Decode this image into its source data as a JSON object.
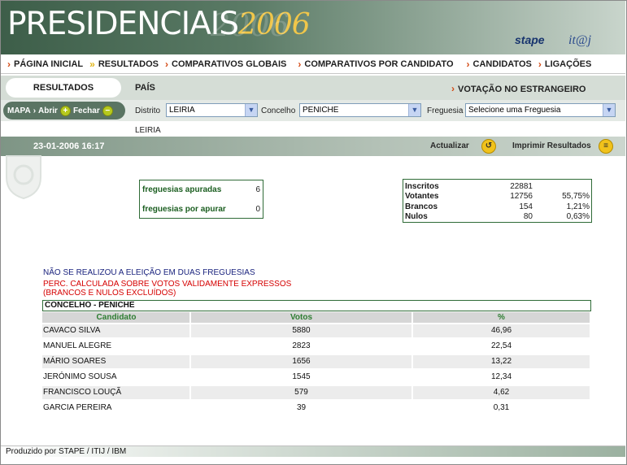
{
  "banner": {
    "title": "PRESIDENCIAIS",
    "year": "2006",
    "logo_stape": "stape",
    "logo_itij": "it@j"
  },
  "nav": [
    "PÁGINA INICIAL",
    "RESULTADOS",
    "COMPARATIVOS GLOBAIS",
    "COMPARATIVOS POR CANDIDATO",
    "CANDIDATOS",
    "LIGAÇÕES"
  ],
  "subnav": {
    "active_tab": "RESULTADOS",
    "pais": "PAÍS",
    "estrangeiro": "VOTAÇÃO NO ESTRANGEIRO"
  },
  "filters": {
    "mapa": "MAPA",
    "abrir": "Abrir",
    "fechar": "Fechar",
    "distrito_label": "Distrito",
    "distrito_value": "LEIRIA",
    "concelho_label": "Concelho",
    "concelho_value": "PENICHE",
    "freguesia_label": "Freguesia",
    "freguesia_value": "Selecione uma Freguesia"
  },
  "breadcrumb": "LEIRIA",
  "status": {
    "datetime": "23-01-2006  16:17",
    "actualizar": "Actualizar",
    "imprimir": "Imprimir Resultados"
  },
  "freguesias": {
    "apuradas_label": "freguesias apuradas",
    "apuradas_value": "6",
    "por_apurar_label": "freguesias por apurar",
    "por_apurar_value": "0"
  },
  "stats": [
    {
      "label": "Inscritos",
      "value": "22881",
      "pct": ""
    },
    {
      "label": "Votantes",
      "value": "12756",
      "pct": "55,75%"
    },
    {
      "label": "Brancos",
      "value": "154",
      "pct": "1,21%"
    },
    {
      "label": "Nulos",
      "value": "80",
      "pct": "0,63%"
    }
  ],
  "notes": {
    "line1": "NÃO SE REALIZOU A ELEIÇÃO EM DUAS FREGUESIAS",
    "line2": "PERC. CALCULADA SOBRE VOTOS VALIDAMENTE EXPRESSOS",
    "line3": "(BRANCOS E NULOS EXCLUÍDOS)"
  },
  "results": {
    "title": "CONCELHO - PENICHE",
    "headers": [
      "Candidato",
      "Votos",
      "%"
    ],
    "rows": [
      {
        "candidato": "CAVACO SILVA",
        "votos": "5880",
        "pct": "46,96"
      },
      {
        "candidato": "MANUEL ALEGRE",
        "votos": "2823",
        "pct": "22,54"
      },
      {
        "candidato": "MÁRIO SOARES",
        "votos": "1656",
        "pct": "13,22"
      },
      {
        "candidato": "JERÓNIMO SOUSA",
        "votos": "1545",
        "pct": "12,34"
      },
      {
        "candidato": "FRANCISCO LOUÇÃ",
        "votos": "579",
        "pct": "4,62"
      },
      {
        "candidato": "GARCIA PEREIRA",
        "votos": "39",
        "pct": "0,31"
      }
    ]
  },
  "footer": "Produzido por STAPE / ITIJ / IBM"
}
